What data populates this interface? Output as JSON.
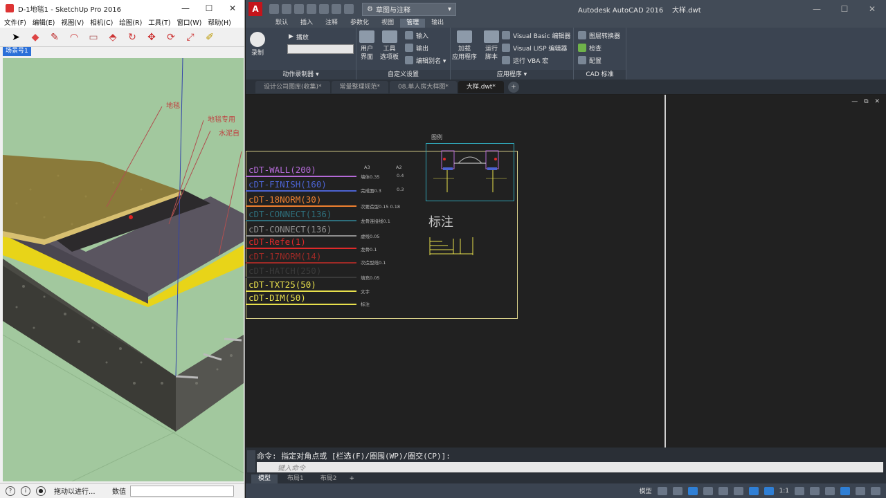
{
  "sketchup": {
    "title": "D-1地毯1 - SketchUp Pro 2016",
    "window_controls": [
      "—",
      "☐",
      "✕"
    ],
    "menu": [
      "文件(F)",
      "编辑(E)",
      "视图(V)",
      "相机(C)",
      "绘图(R)",
      "工具(T)",
      "窗口(W)",
      "帮助(H)"
    ],
    "scene_tab": "场景号1",
    "callouts": [
      "地毯",
      "地毯专用",
      "水泥自"
    ],
    "status": {
      "hint": "拖动以进行...",
      "measure_label": "数值"
    }
  },
  "autocad": {
    "app_title": "Autodesk AutoCAD 2016",
    "doc_title": "大样.dwt",
    "logo_letter": "A",
    "workspace": "草图与注释",
    "window_controls": [
      "—",
      "☐",
      "✕"
    ],
    "ribbon_tabs": [
      {
        "label": "默认",
        "active": false
      },
      {
        "label": "插入",
        "active": false
      },
      {
        "label": "注释",
        "active": false
      },
      {
        "label": "参数化",
        "active": false
      },
      {
        "label": "视图",
        "active": false
      },
      {
        "label": "管理",
        "active": true
      },
      {
        "label": "输出",
        "active": false
      }
    ],
    "ribbon": {
      "record": {
        "record_label": "录制",
        "play_label": "播放",
        "title": "动作录制器 ▾"
      },
      "customize": {
        "cui_label_1": "用户",
        "cui_label_2": "界面",
        "palettes_label_1": "工具",
        "palettes_label_2": "选项板",
        "import_label": "输入",
        "export_label": "输出",
        "alias_label": "编辑别名 ▾",
        "title": "自定义设置"
      },
      "apps": {
        "load_label_1": "加载",
        "load_label_2": "应用程序",
        "run_label_1": "运行",
        "run_label_2": "脚本",
        "vba_editor": "Visual Basic 编辑器",
        "lisp_editor": "Visual LISP 编辑器",
        "run_vba": "运行 VBA 宏",
        "title": "应用程序 ▾"
      },
      "cad_standards": {
        "layer_translator": "图层转换器",
        "check": "检查",
        "configure": "配置",
        "title": "CAD 标准"
      }
    },
    "doc_tabs": [
      {
        "label": "设计公司图库(收集)*",
        "active": false
      },
      {
        "label": "常量整理规范*",
        "active": false
      },
      {
        "label": "08.单人房大样图*",
        "active": false
      },
      {
        "label": "大样.dwt*",
        "active": true
      }
    ],
    "layers": [
      {
        "name": "cDT-WALL(200)",
        "color": "#b56ad8"
      },
      {
        "name": "cDT-FINISH(160)",
        "color": "#4c63d2"
      },
      {
        "name": "cDT-18NORM(30)",
        "color": "#ef8030"
      },
      {
        "name": "cDT-CONNECT(136)",
        "color": "#2e6f7c"
      },
      {
        "name": "cDT-CONNECT(136)",
        "color": "#8e8e8e"
      },
      {
        "name": "cDT-Refe(1)",
        "color": "#e02a2a"
      },
      {
        "name": "cDT-17NORM(14)",
        "color": "#9e2a26"
      },
      {
        "name": "cDT-HATCH(250)",
        "color": "#3a3a3a"
      },
      {
        "name": "cDT-TXT25(50)",
        "color": "#e8e04c"
      },
      {
        "name": "cDT-DIM(50)",
        "color": "#e8e04c"
      }
    ],
    "layer_notes": [
      "墙体0.35",
      "完成面0.3",
      "次要造型0.15 0.18",
      "龙骨连接线0.1",
      "虚线0.05",
      "龙骨0.1",
      "次造型线0.1",
      "填充0.05",
      "文字",
      "标注"
    ],
    "scale_headers": [
      "A3",
      "A2"
    ],
    "scale_values": [
      [
        "0.4"
      ],
      [
        "0.3"
      ]
    ],
    "legend_title": "图例",
    "annotation_label": "标注",
    "command_history": "命令: 指定对角点或 [栏选(F)/圈围(WP)/圈交(CP)]:",
    "command_placeholder": "键入命令",
    "layout_tabs": [
      {
        "label": "模型",
        "active": true
      },
      {
        "label": "布局1",
        "active": false
      },
      {
        "label": "布局2",
        "active": false
      }
    ],
    "status_bar": {
      "model_label": "模型",
      "scale": "1:1"
    },
    "viewport_controls": "— ⧉ ✕"
  },
  "colors": {
    "autocad_bg": "#212121",
    "sketchup_viewport": "#a2c89e",
    "frame_yellow": "#d8d08a"
  }
}
